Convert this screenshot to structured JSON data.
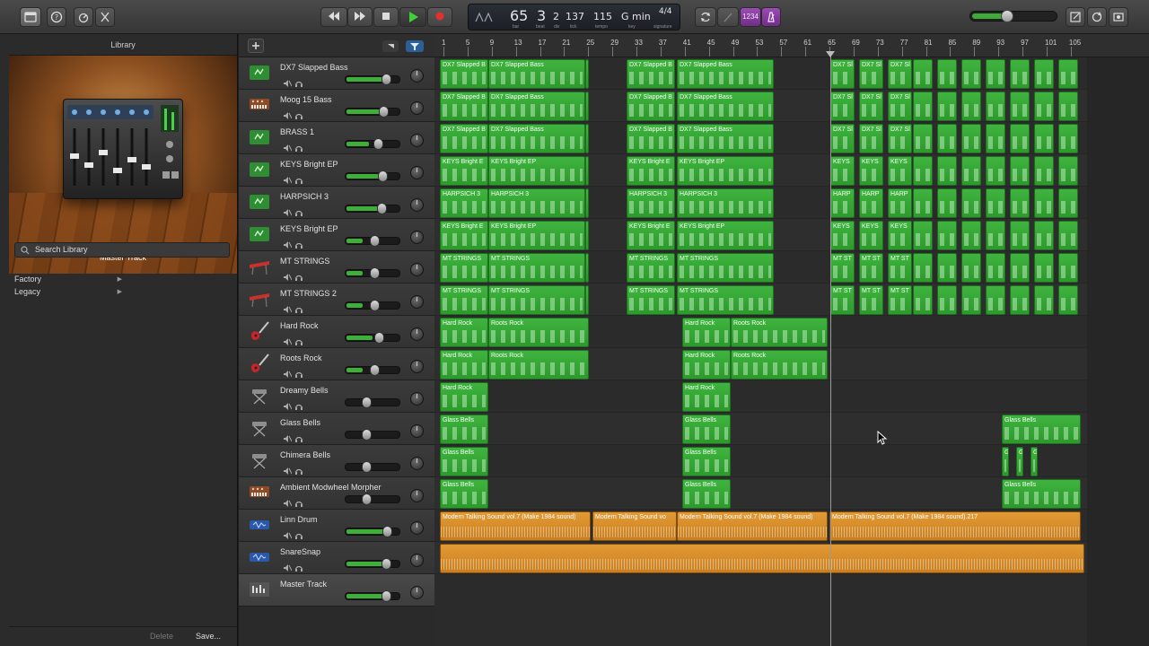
{
  "library": {
    "title": "Library",
    "image_caption": "Master Track",
    "search_placeholder": "Search Library",
    "items": [
      {
        "label": "Factory"
      },
      {
        "label": "Legacy"
      }
    ],
    "delete_label": "Delete",
    "save_label": "Save..."
  },
  "lcd": {
    "bar": "65",
    "beat": "3",
    "div": "2",
    "tick": "137",
    "bar_label": "bar",
    "beat_label": "beat",
    "div_label": "div",
    "tick_label": "tick",
    "tempo": "115",
    "tempo_label": "tempo",
    "key": "G min",
    "key_label": "key",
    "signature": "4/4",
    "signature_label": "signature"
  },
  "toolbar": {
    "count_in_label": "1234",
    "master_volume": 0.4
  },
  "ruler": {
    "bars": [
      "1",
      "5",
      "9",
      "13",
      "17",
      "21",
      "25",
      "29",
      "33",
      "37",
      "41",
      "45",
      "49",
      "53",
      "57",
      "61",
      "65",
      "69",
      "73",
      "77",
      "81",
      "85",
      "89",
      "93",
      "97",
      "101",
      "105"
    ]
  },
  "tracks": [
    {
      "name": "DX7 Slapped Bass",
      "icon": "keyboard-green-icon",
      "volume": 0.72
    },
    {
      "name": "Moog 15 Bass",
      "icon": "synth-brown-icon",
      "volume": 0.62
    },
    {
      "name": "BRASS  1",
      "icon": "keyboard-green-icon",
      "volume": 0.42
    },
    {
      "name": "KEYS Bright EP",
      "icon": "keyboard-green-icon",
      "volume": 0.6
    },
    {
      "name": "HARPSICH 3",
      "icon": "keyboard-green-icon",
      "volume": 0.58
    },
    {
      "name": "KEYS Bright EP",
      "icon": "keyboard-green-icon",
      "volume": 0.3
    },
    {
      "name": "MT STRINGS",
      "icon": "keyboard-red-icon",
      "volume": 0.3
    },
    {
      "name": "MT STRINGS 2",
      "icon": "keyboard-red-icon",
      "volume": 0.3
    },
    {
      "name": "Hard Rock",
      "icon": "electric-guitar-icon",
      "volume": 0.48
    },
    {
      "name": "Roots Rock",
      "icon": "electric-guitar-icon",
      "volume": 0.3
    },
    {
      "name": "Dreamy Bells",
      "icon": "keyboard-stand-icon",
      "volume": 0.0
    },
    {
      "name": "Glass Bells",
      "icon": "keyboard-stand-icon",
      "volume": 0.0
    },
    {
      "name": "Chimera Bells",
      "icon": "keyboard-stand-icon",
      "volume": 0.0
    },
    {
      "name": "Ambient Modwheel Morpher",
      "icon": "synth-brown-icon",
      "volume": 0.0
    },
    {
      "name": "Linn Drum",
      "icon": "audio-waveform-icon",
      "volume": 0.78
    },
    {
      "name": "SnareSnap",
      "icon": "audio-waveform-icon",
      "volume": 0.72
    },
    {
      "name": "Master Track",
      "icon": "master-track-icon",
      "volume": 0.72
    }
  ],
  "lanes": [
    {
      "regions": [
        {
          "label": "DX7 Slapped B"
        },
        {
          "label": "DX7 Slapped Bass"
        },
        {
          "label": "DX7 Slapped Bass"
        },
        {
          "label": "DX7 Slapped B"
        },
        {
          "label": "DX7 Slapped Bass"
        },
        {
          "label": "DX7 Sl"
        },
        {
          "label": "DX7 Sl"
        },
        {
          "label": "DX7 Sl"
        }
      ]
    },
    {
      "regions": [
        {
          "label": "DX7 Slapped B"
        },
        {
          "label": "DX7 Slapped Bass"
        },
        {
          "label": "DX7 Slapped Bass"
        },
        {
          "label": "DX7 Slapped B"
        },
        {
          "label": "DX7 Slapped Bass"
        },
        {
          "label": "DX7 Sl"
        },
        {
          "label": "DX7 Sl"
        },
        {
          "label": "DX7 Sl"
        }
      ]
    },
    {
      "regions": [
        {
          "label": "DX7 Slapped B"
        },
        {
          "label": "DX7 Slapped Bass"
        },
        {
          "label": "DX7 Slapped Bass"
        },
        {
          "label": "DX7 Slapped B"
        },
        {
          "label": "DX7 Slapped Bass"
        },
        {
          "label": "DX7 Sl"
        },
        {
          "label": "DX7 Sl"
        },
        {
          "label": "DX7 Sl"
        }
      ]
    },
    {
      "regions": [
        {
          "label": "KEYS Bright E"
        },
        {
          "label": "KEYS Bright EP"
        },
        {
          "label": "KEYS"
        },
        {
          "label": "KEYS Bright E"
        },
        {
          "label": "KEYS Bright EP"
        },
        {
          "label": "KEYS"
        },
        {
          "label": "KEYS"
        },
        {
          "label": "KEYS"
        }
      ]
    },
    {
      "regions": [
        {
          "label": "HARPSICH 3"
        },
        {
          "label": "HARPSICH 3"
        },
        {
          "label": "HARP"
        },
        {
          "label": "HARPSICH 3"
        },
        {
          "label": "HARPSICH 3"
        },
        {
          "label": "HARP"
        },
        {
          "label": "HARP"
        },
        {
          "label": "HARP"
        }
      ]
    },
    {
      "regions": [
        {
          "label": "KEYS Bright E"
        },
        {
          "label": "KEYS Bright EP"
        },
        {
          "label": "KEYS"
        },
        {
          "label": "KEYS Bright E"
        },
        {
          "label": "KEYS Bright EP"
        },
        {
          "label": "KEYS"
        },
        {
          "label": "KEYS"
        },
        {
          "label": "KEYS"
        }
      ]
    },
    {
      "regions": [
        {
          "label": "MT STRINGS"
        },
        {
          "label": "MT STRINGS"
        },
        {
          "label": "MT ST"
        },
        {
          "label": "MT STRINGS"
        },
        {
          "label": "MT STRINGS"
        },
        {
          "label": "MT ST"
        },
        {
          "label": "MT ST"
        },
        {
          "label": "MT ST"
        }
      ]
    },
    {
      "regions": [
        {
          "label": "MT STRINGS"
        },
        {
          "label": "MT STRINGS"
        },
        {
          "label": "MT ST"
        },
        {
          "label": "MT STRINGS"
        },
        {
          "label": "MT STRINGS"
        },
        {
          "label": "MT ST"
        },
        {
          "label": "MT ST"
        },
        {
          "label": "MT ST"
        }
      ]
    },
    {
      "regions": [
        {
          "label": "Hard Rock"
        },
        {
          "label": "Roots Rock"
        },
        {
          "label": "Hard Rock"
        },
        {
          "label": "Roots Rock"
        }
      ]
    },
    {
      "regions": [
        {
          "label": "Hard Rock"
        },
        {
          "label": "Roots Rock"
        },
        {
          "label": "Hard Rock"
        },
        {
          "label": "Roots Rock"
        }
      ]
    },
    {
      "regions": [
        {
          "label": "Hard Rock"
        },
        {
          "label": "Hard Rock"
        }
      ]
    },
    {
      "regions": [
        {
          "label": "Glass Bells"
        },
        {
          "label": "Glass Bells"
        },
        {
          "label": "Glass Bells"
        }
      ]
    },
    {
      "regions": [
        {
          "label": "Glass Bells"
        },
        {
          "label": "Glass Bells"
        },
        {
          "label": "Gl"
        },
        {
          "label": "Gl"
        },
        {
          "label": "Gl"
        }
      ]
    },
    {
      "regions": [
        {
          "label": "Glass Bells"
        },
        {
          "label": "Glass Bells"
        },
        {
          "label": "Glass Bells"
        }
      ]
    },
    {
      "regions": [
        {
          "label": "Modern Talking Sound vol.7 (Make 1984 sound)"
        },
        {
          "label": "Modern Talking Sound vo"
        },
        {
          "label": "Modern Talking Sound vol.7 (Make 1984 sound)"
        },
        {
          "label": "Modern Talking Sound vol.7 (Make 1984 sound).217"
        }
      ]
    },
    {
      "regions": [
        {
          "label": ""
        }
      ]
    }
  ],
  "colors": {
    "midi_region": "#3fb33f",
    "audio_region": "#e29a35",
    "accent_purple": "#8a3fa0"
  }
}
